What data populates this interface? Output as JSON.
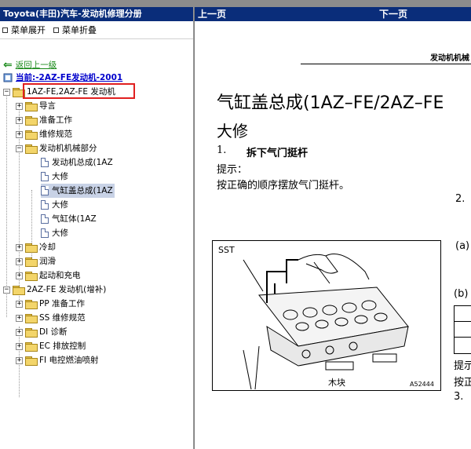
{
  "left_panel": {
    "title": "Toyota(丰田)汽车-发动机修理分册",
    "toolbar": {
      "expand": "菜单展开",
      "collapse": "菜单折叠"
    },
    "back_link": "返回上一级",
    "current": "当前:-2AZ-FE发动机-2001",
    "tree": [
      {
        "label": "1AZ-FE,2AZ-FE 发动机",
        "expander": "−"
      },
      {
        "label": "导言",
        "expander": "+"
      },
      {
        "label": "准备工作",
        "expander": "+"
      },
      {
        "label": "维修规范",
        "expander": "+"
      },
      {
        "label": "发动机机械部分",
        "expander": "−"
      },
      {
        "label": "发动机总成(1AZ"
      },
      {
        "label": "大修"
      },
      {
        "label": "气缸盖总成(1AZ"
      },
      {
        "label": "大修"
      },
      {
        "label": "气缸体(1AZ"
      },
      {
        "label": "大修"
      },
      {
        "label": "冷却",
        "expander": "+"
      },
      {
        "label": "润滑",
        "expander": "+"
      },
      {
        "label": "起动和充电",
        "expander": "+"
      },
      {
        "label": "2AZ-FE 发动机(增补)",
        "expander": "−"
      },
      {
        "label": "PP 准备工作",
        "expander": "+"
      },
      {
        "label": "SS 维修规范",
        "expander": "+"
      },
      {
        "label": "DI 诊断",
        "expander": "+"
      },
      {
        "label": "EC 排放控制",
        "expander": "+"
      },
      {
        "label": "FI 电控燃油喷射",
        "expander": "+"
      }
    ]
  },
  "right_panel": {
    "nav": {
      "prev": "上一页",
      "next": "下一页"
    },
    "doc": {
      "header_right": "发动机机械",
      "title_line1": "气缸盖总成(1AZ–FE/2AZ–FE",
      "title_line2": "大修",
      "step1_num": "1.",
      "step1_text": "拆下气门挺杆",
      "hint_label": "提示：",
      "hint_text": "按正确的顺序摆放气门挺杆。",
      "step2_num": "2.",
      "sub_a": "(a)",
      "sub_b": "(b)",
      "right_frag_1": "提示",
      "right_frag_2": "按正",
      "step3_num": "3.",
      "figure": {
        "sst_label": "SST",
        "block_label": "木块",
        "figure_id": "A52444"
      }
    }
  },
  "colors": {
    "title_bar": "#0a2d7a",
    "link_green": "#1a8a1a",
    "current_blue": "#0000cc",
    "highlight_red": "#e02020",
    "selection": "#c8d2e6"
  }
}
